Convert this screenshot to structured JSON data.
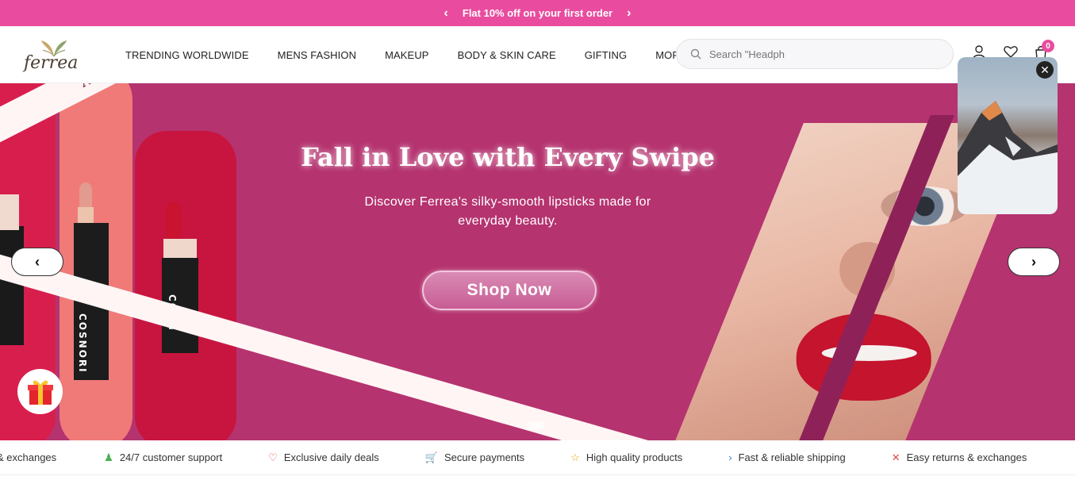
{
  "announcement": {
    "text": "Flat 10% off on your first order",
    "prev_icon": "chevron-left-icon",
    "next_icon": "chevron-right-icon"
  },
  "header": {
    "logo_text": "ferrea",
    "nav": [
      "TRENDING WORLDWIDE",
      "MENS FASHION",
      "MAKEUP",
      "BODY & SKIN CARE",
      "GIFTING",
      "MORE"
    ],
    "search_placeholder": "Search \"Headph",
    "cart_count": "0"
  },
  "hero": {
    "ribbon_text": "A shade for every mood",
    "title": "Fall in Love with Every Swipe",
    "subtitle": "Discover Ferrea's silky-smooth lipsticks made for everyday beauty.",
    "cta": "Shop Now",
    "brand_text": "COSNORI",
    "brand_text_partial": "CO RI"
  },
  "features": [
    {
      "icon": "close-icon",
      "label": "& exchanges",
      "color": "#e04848"
    },
    {
      "icon": "person-icon",
      "label": "24/7 customer support",
      "color": "#4caf50"
    },
    {
      "icon": "heart-icon",
      "label": "Exclusive daily deals",
      "color": "#e04848"
    },
    {
      "icon": "cart-icon",
      "label": "Secure payments",
      "color": "#c2185b"
    },
    {
      "icon": "star-icon",
      "label": "High quality products",
      "color": "#e0a800"
    },
    {
      "icon": "chevron-right-icon",
      "label": "Fast & reliable shipping",
      "color": "#3a7bd5"
    },
    {
      "icon": "close-icon",
      "label": "Easy returns & exchanges",
      "color": "#e04848"
    }
  ],
  "colors": {
    "accent": "#e94c9f",
    "hero_bg": "#b5336f"
  }
}
